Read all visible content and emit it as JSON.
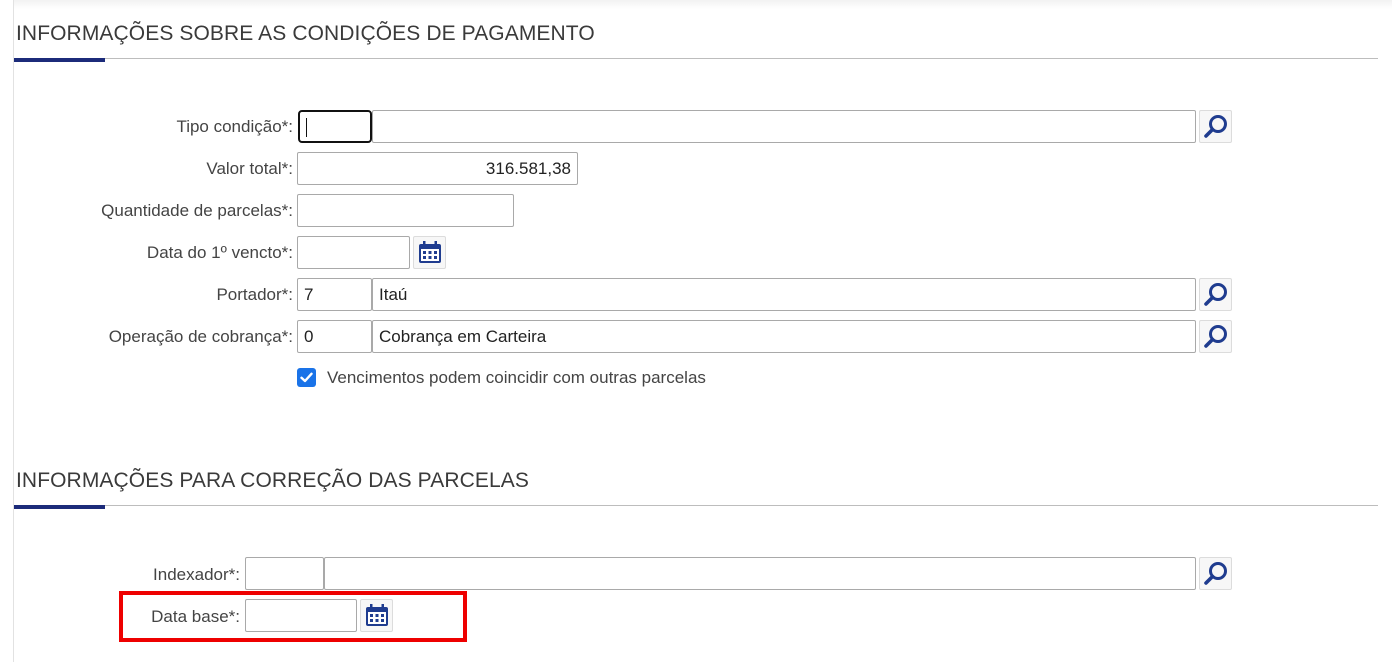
{
  "section_payment": {
    "title": "INFORMAÇÕES SOBRE AS CONDIÇÕES DE PAGAMENTO",
    "tipo_condicao": {
      "label": "Tipo condição*:",
      "code": "",
      "description": ""
    },
    "valor_total": {
      "label": "Valor total*:",
      "value": "316.581,38"
    },
    "quantidade_parcelas": {
      "label": "Quantidade de parcelas*:",
      "value": ""
    },
    "data_vencto": {
      "label": "Data do 1º vencto*:",
      "value": ""
    },
    "portador": {
      "label": "Portador*:",
      "code": "7",
      "description": "Itaú"
    },
    "operacao_cobranca": {
      "label": "Operação de cobrança*:",
      "code": "0",
      "description": "Cobrança em Carteira"
    },
    "vencimentos_checkbox": {
      "label": "Vencimentos podem coincidir com outras parcelas",
      "checked": true
    }
  },
  "section_correction": {
    "title": "INFORMAÇÕES PARA CORREÇÃO DAS PARCELAS",
    "indexador": {
      "label": "Indexador*:",
      "code": "",
      "description": ""
    },
    "data_base": {
      "label": "Data base*:",
      "value": ""
    }
  },
  "icons": {
    "lookup": "magnifier-icon",
    "calendar": "calendar-icon",
    "check": "checkmark-icon"
  },
  "colors": {
    "accent": "#1c2b7a",
    "icon": "#1f3c8f",
    "checkbox": "#1a73e8",
    "highlight": "#ee0000"
  }
}
